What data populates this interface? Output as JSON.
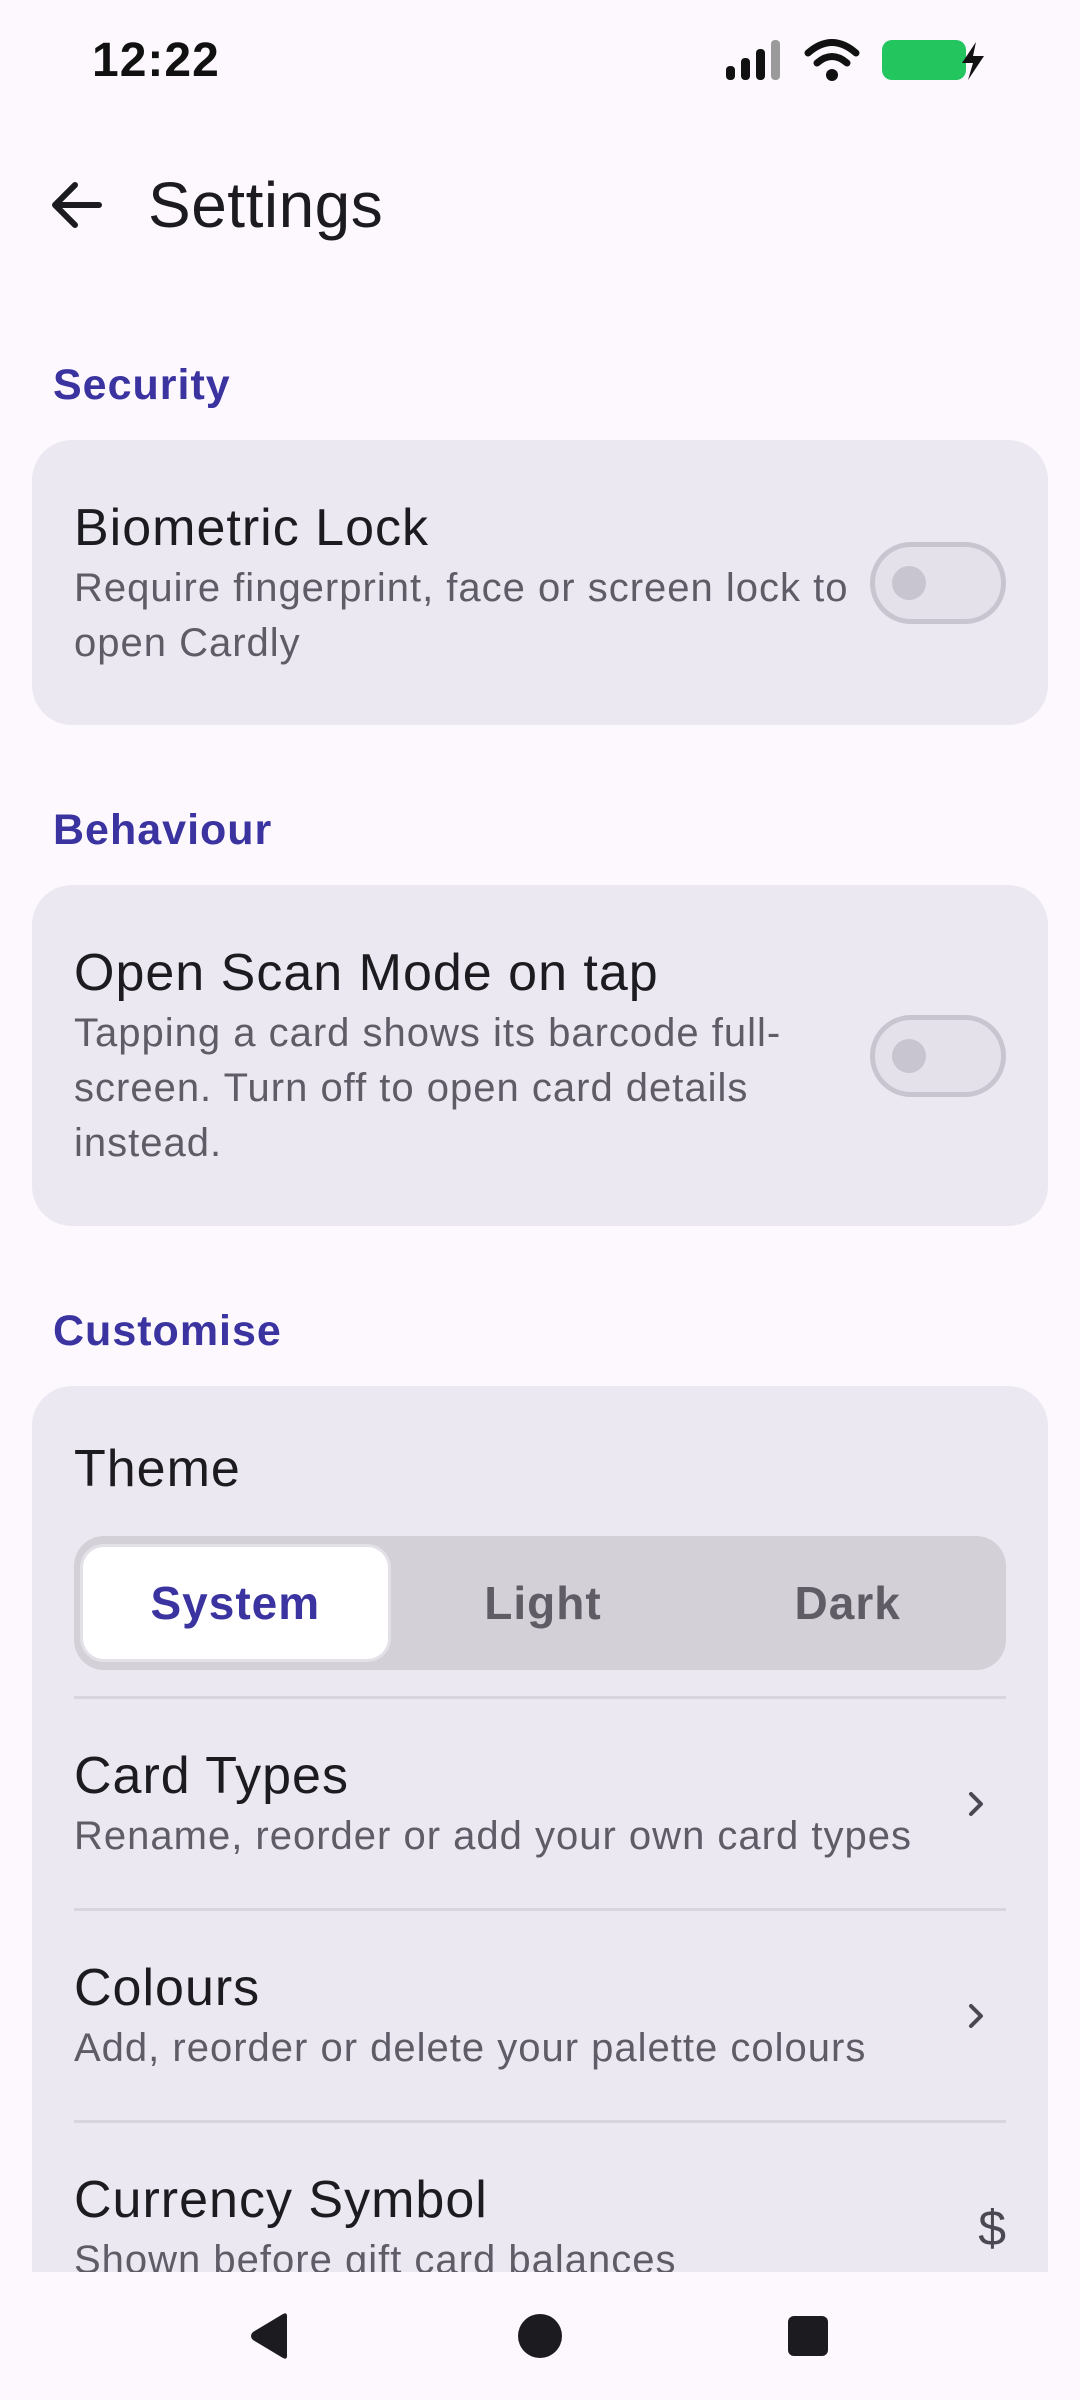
{
  "status_bar": {
    "time": "12:22",
    "battery_color": "#22c55e"
  },
  "app_bar": {
    "title": "Settings",
    "back_icon": "arrow-left-icon"
  },
  "sections": {
    "security": {
      "header": "Security",
      "biometric": {
        "title": "Biometric Lock",
        "subtitle": "Require fingerprint, face or screen lock to open Cardly",
        "enabled": false
      }
    },
    "behaviour": {
      "header": "Behaviour",
      "scan_mode": {
        "title": "Open Scan Mode on tap",
        "subtitle": "Tapping a card shows its barcode full-screen. Turn off to open card details instead.",
        "enabled": false
      }
    },
    "customise": {
      "header": "Customise",
      "theme": {
        "title": "Theme",
        "options": [
          "System",
          "Light",
          "Dark"
        ],
        "selected": "System"
      },
      "card_types": {
        "title": "Card Types",
        "subtitle": "Rename, reorder or add your own card types"
      },
      "colours": {
        "title": "Colours",
        "subtitle": "Add, reorder or delete your palette colours"
      },
      "currency": {
        "title": "Currency Symbol",
        "subtitle": "Shown before gift card balances",
        "value": "$"
      }
    }
  },
  "accent_color": "#3a33a0",
  "nav_bar": {
    "icons": [
      "back-triangle-icon",
      "home-circle-icon",
      "recents-square-icon"
    ]
  }
}
